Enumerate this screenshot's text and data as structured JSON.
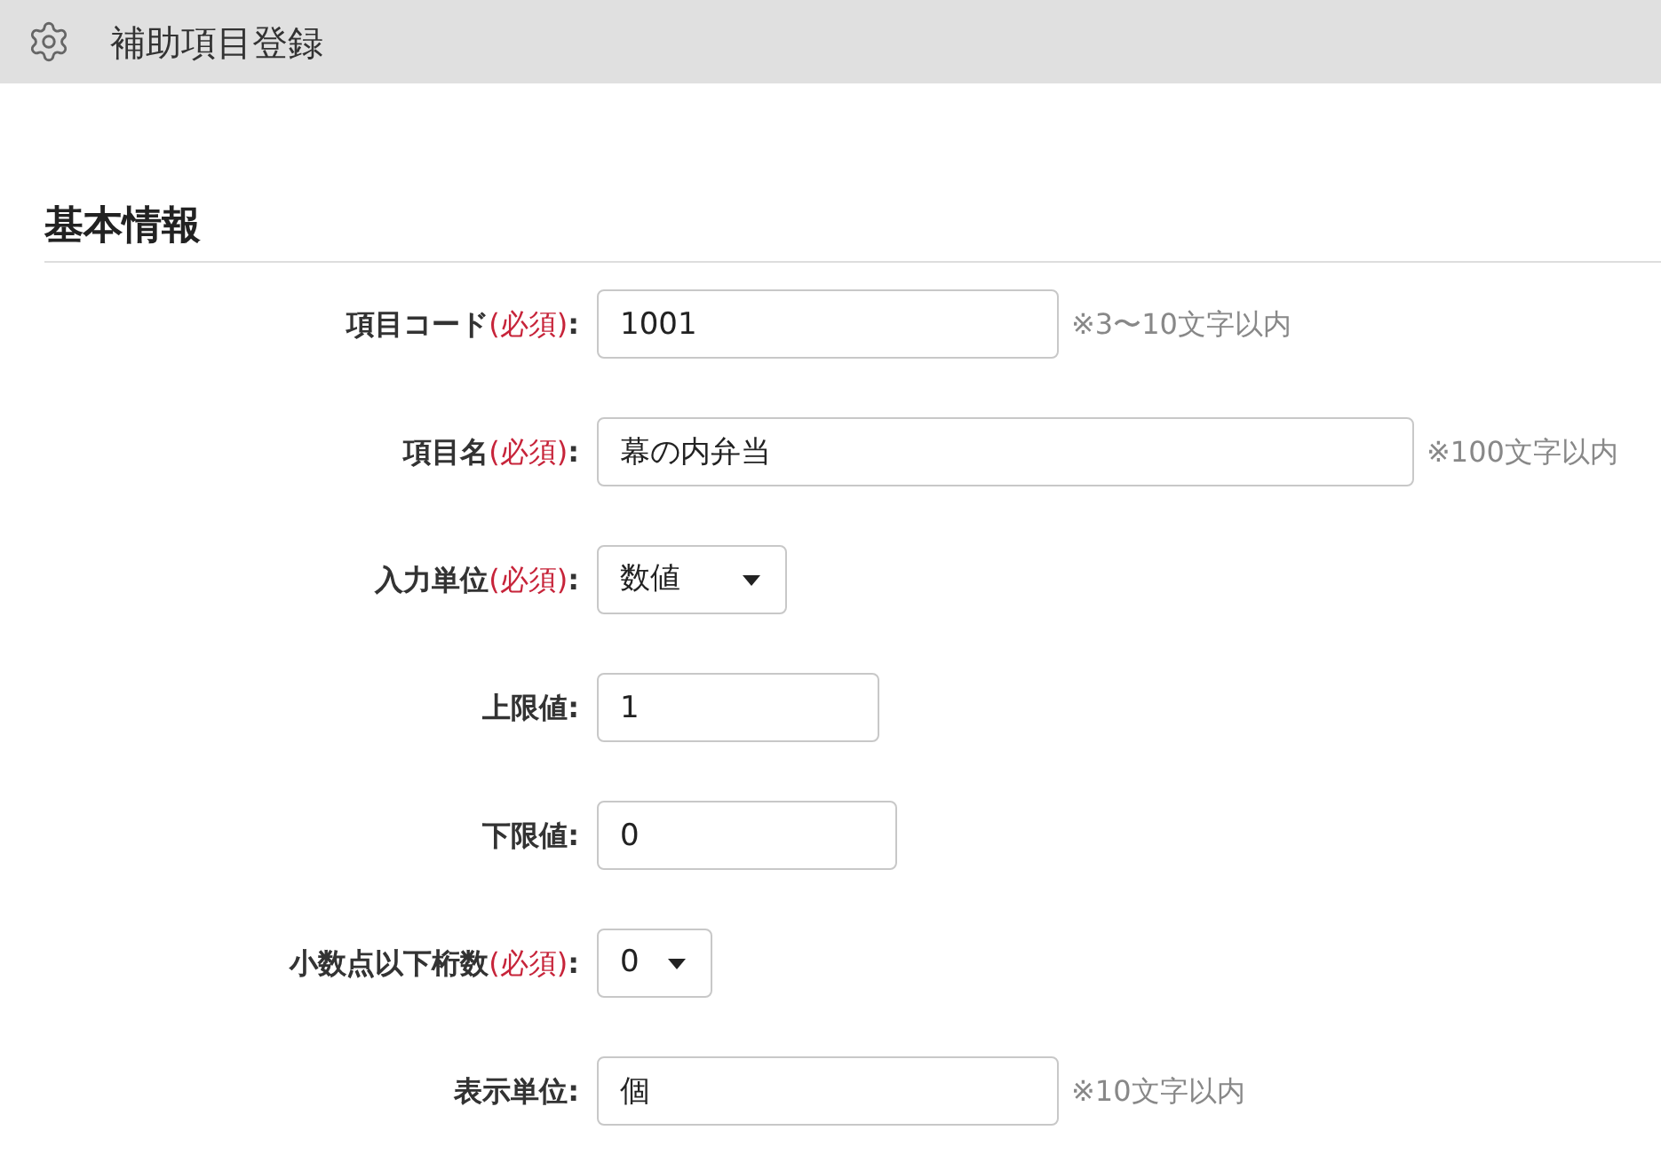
{
  "header": {
    "title": "補助項目登録"
  },
  "section": {
    "title": "基本情報"
  },
  "fields": [
    {
      "kind": "text",
      "label": "項目コード",
      "required_mark": "(必須)",
      "colon": ":",
      "value": "1001",
      "hint": "※3〜10文字以内"
    },
    {
      "kind": "text",
      "label": "項目名",
      "required_mark": "(必須)",
      "colon": ":",
      "value": "幕の内弁当",
      "hint": "※100文字以内"
    },
    {
      "kind": "select",
      "label": "入力単位",
      "required_mark": "(必須)",
      "colon": ":",
      "value": "数値"
    },
    {
      "kind": "text",
      "label": "上限値",
      "colon": ":",
      "value": "1"
    },
    {
      "kind": "text",
      "label": "下限値",
      "colon": ":",
      "value": "0"
    },
    {
      "kind": "select",
      "label": "小数点以下桁数",
      "required_mark": "(必須)",
      "colon": ":",
      "value": "0"
    },
    {
      "kind": "text",
      "label": "表示単位",
      "colon": ":",
      "value": "個",
      "hint": "※10文字以内"
    }
  ]
}
